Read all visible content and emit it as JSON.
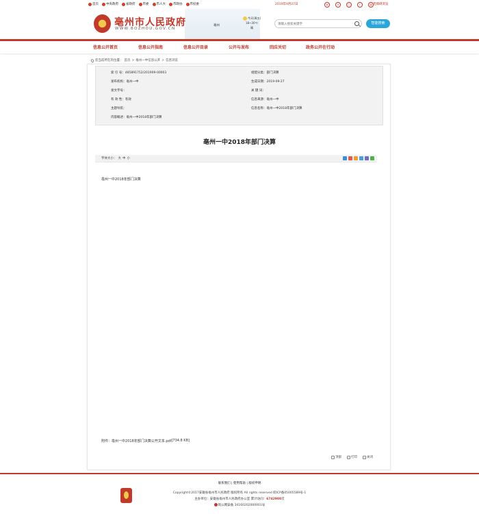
{
  "topbar": {
    "links": [
      "首页",
      "中央政府",
      "省政府",
      "市委",
      "市人大",
      "市政协",
      "市纪委"
    ],
    "date": "2019年9月27日",
    "social_icons": [
      "weibo-icon",
      "weixin-icon",
      "phone-icon",
      "rss-icon",
      "mail-icon"
    ],
    "accessibility": "无障碍浏览"
  },
  "header": {
    "logo_cn": "亳州市人民政府",
    "logo_en": "WWW.BOZHOU.GOV.CN",
    "city": "亳州",
    "weather_today": "今天(周五)",
    "weather_temp": "18~30℃",
    "weather_cond": "晴",
    "search_placeholder": "请输入搜索关键字",
    "smart_search": "智能搜索"
  },
  "nav": {
    "items": [
      "信息公开首页",
      "信息公开指南",
      "信息公开目录",
      "公开与发布",
      "回应关切",
      "政务公开在行动"
    ]
  },
  "breadcrumb": {
    "prefix": "您当前所在的位置：",
    "path": [
      "首页",
      "亳州一中信息公开",
      "信息浏览"
    ]
  },
  "meta": {
    "index_label": "索 引 号：",
    "index_value": "485891752/201909-00003",
    "category_label": "组配分类：",
    "category_value": "部门决算",
    "publisher_label": "发布机构：",
    "publisher_value": "亳州一中",
    "date_label": "生成日期：",
    "date_value": "2019-09-27",
    "docno_label": "发文字号：",
    "docno_value": "",
    "keywords_label": "关 键 词：",
    "keywords_value": "",
    "validity_label": "有 效 性：",
    "validity_value": "有效",
    "source_label": "信息来源：",
    "source_value": "亳州一中",
    "topic_label": "主题导航：",
    "topic_value": "",
    "name_label": "信息名称：",
    "name_value": "亳州一中2018年部门决算",
    "summary_label": "内容概述：",
    "summary_value": "亳州一中2018年部门决算"
  },
  "article": {
    "title": "亳州一中2018年部门决算",
    "fontsize_label": "字体大小：",
    "fontsize_options": [
      "大",
      "中",
      "小"
    ],
    "body": "亳州一中2018年部门决算",
    "attachment_label": "附件：",
    "attachment_name": "亳州一中2018年部门决算公开文本.pdf",
    "attachment_size": " [734.8 KB]",
    "share_colors": [
      "#3b8ede",
      "#e05b4c",
      "#f29c38",
      "#4a9fd8",
      "#6a6fc4",
      "#52b04a"
    ]
  },
  "actions": [
    "顶部",
    "打印",
    "关闭"
  ],
  "footer": {
    "links": "联系我们 | 使用帮助 | 版权申明",
    "copyright": "Copyright©2017安徽省亳州市人民政府  版权所有 All rights reserved 皖ICP备05005589号-1",
    "host_pre": "主办单位：安徽省亳州市人民政府办公室    累计访问：",
    "visits": "6742900",
    "host_post": "次",
    "police": "皖公网安备 34160202000001号"
  }
}
